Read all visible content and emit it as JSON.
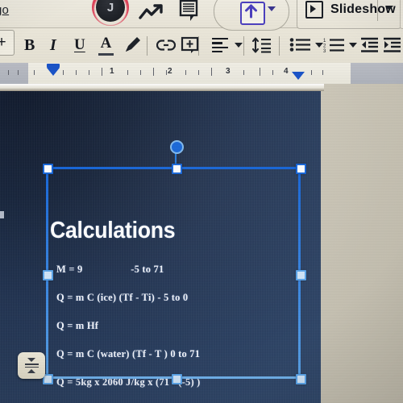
{
  "app": {
    "name": "Google Slides",
    "view": "slide-editor"
  },
  "chrome": {
    "menu_partial_label": "go",
    "avatar_initial": "J",
    "trend_icon": "trend-chart-icon",
    "comment_icon": "comment-icon",
    "share_icon": "share-upload-icon",
    "share_caret": "chevron-down-icon",
    "slideshow_label": "Slideshow",
    "slideshow_icon": "play-box-icon",
    "slideshow_caret": "chevron-down-icon"
  },
  "format_toolbar": {
    "add_label": "+",
    "bold_label": "B",
    "italic_label": "I",
    "underline_label": "U",
    "text_color_label": "A",
    "items": [
      {
        "name": "add-button",
        "label": "+"
      },
      {
        "name": "bold-button",
        "label": "B"
      },
      {
        "name": "italic-button",
        "label": "I"
      },
      {
        "name": "underline-button",
        "label": "U"
      },
      {
        "name": "text-color-button",
        "label": "A"
      },
      {
        "name": "highlight-pen-button",
        "label": "pen-icon"
      },
      {
        "name": "insert-link-button",
        "label": "link-icon"
      },
      {
        "name": "insert-comment-button",
        "label": "comment-box-icon"
      },
      {
        "name": "align-button",
        "label": "align-left-icon"
      },
      {
        "name": "line-spacing-button",
        "label": "line-spacing-icon"
      },
      {
        "name": "bulleted-list-button",
        "label": "bulleted-list-icon"
      },
      {
        "name": "numbered-list-button",
        "label": "numbered-list-icon"
      },
      {
        "name": "decrease-indent-button",
        "label": "decrease-indent-icon"
      },
      {
        "name": "increase-indent-button",
        "label": "increase-indent-icon"
      }
    ]
  },
  "ruler": {
    "numbers": [
      "1",
      "2",
      "3",
      "4"
    ],
    "left_indent_marker": "left-indent-marker",
    "right_indent_marker": "right-indent-marker"
  },
  "slide": {
    "title": "Calculations",
    "background_color": "#16233a",
    "accent_color": "#1f7ae0",
    "body_lines": [
      "M = 9                  -5 to 71",
      "Q = m C (ice) (Tf - Ti) - 5 to 0",
      "Q = m Hf",
      "Q = m C (water) (Tf - T ) 0 to 71",
      "Q = 5kg x 2060 J/kg x (71 - (-5) )"
    ]
  },
  "selection": {
    "state": "textbox-selected",
    "rotate_handle": "rotation-handle",
    "handles": [
      "handle-top-left",
      "handle-top-center",
      "handle-top-right",
      "handle-middle-left",
      "handle-middle-right",
      "handle-bottom-left",
      "handle-bottom-center",
      "handle-bottom-right"
    ]
  },
  "floating_button": {
    "name": "line-spacing-popup-button"
  }
}
